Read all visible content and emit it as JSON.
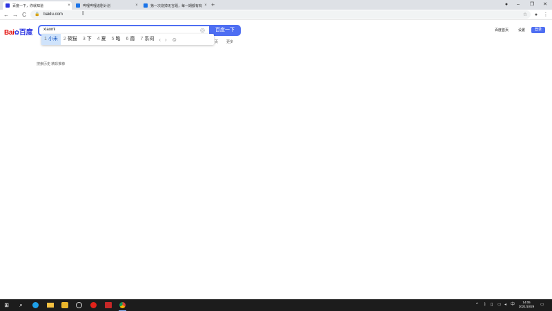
{
  "browser": {
    "tabs": [
      {
        "title": "百度一下，你就知道",
        "favicon_color": "#2932e1",
        "active": true
      },
      {
        "title": "哔哩哔哩追剧计划",
        "favicon_color": "#1a73e8",
        "active": false
      },
      {
        "title": "第一次烧掉无言题，每一期都有有",
        "favicon_color": "#1a73e8",
        "active": false
      }
    ],
    "new_tab": "+",
    "window_controls": {
      "profile": "●",
      "minimize": "–",
      "restore": "❐",
      "close": "✕"
    },
    "nav": {
      "back": "←",
      "forward": "→",
      "reload": "C"
    },
    "address": {
      "lock": "🔒",
      "url": "baidu.com"
    },
    "toolbar_icons": {
      "star": "☆",
      "extensions": "●",
      "menu": "⋮"
    },
    "close_glyph": "×"
  },
  "baidu": {
    "logo": {
      "part1": "Bai",
      "paw": "✿",
      "part2": "百度"
    },
    "search": {
      "value": "xiaomi",
      "camera_icon": "◎",
      "button": "百度一下"
    },
    "ime": {
      "candidates": [
        {
          "n": "1",
          "text": "小米",
          "selected": true
        },
        {
          "n": "2",
          "text": "筱猫",
          "selected": false
        },
        {
          "n": "3",
          "text": "下",
          "selected": false
        },
        {
          "n": "4",
          "text": "夏",
          "selected": false
        },
        {
          "n": "5",
          "text": "略",
          "selected": false
        },
        {
          "n": "6",
          "text": "霞",
          "selected": false
        },
        {
          "n": "7",
          "text": "系闷",
          "selected": false
        }
      ],
      "prev": "‹",
      "next": "›",
      "emoji": "☺"
    },
    "subnav": [
      "页",
      "更多"
    ],
    "history_link": "搜索历史 精彩推荐",
    "top_links": {
      "settings": "百度首页",
      "settings2": "设置",
      "login": "登录"
    }
  },
  "taskbar": {
    "start": "⊞",
    "search": "⌕",
    "tray": {
      "chevron": "^",
      "lang": "中",
      "network": "▭",
      "volume": "◂",
      "battery": "▯"
    },
    "clock": {
      "time": "14:05",
      "date": "2021/10/29"
    }
  }
}
